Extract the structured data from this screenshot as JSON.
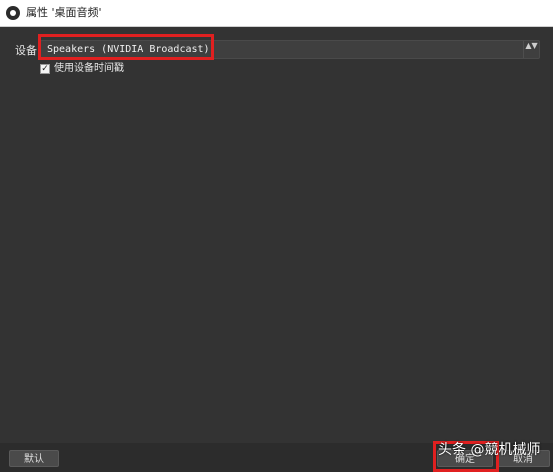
{
  "window": {
    "title": "属性 '桌面音频'",
    "icon": "obs-logo-icon"
  },
  "form": {
    "device_label": "设备",
    "device_value": "Speakers (NVIDIA Broadcast)",
    "combo_arrow": "▲▼",
    "use_timestamp_label": "使用设备时间戳",
    "use_timestamp_checked": true,
    "check_mark": "✓"
  },
  "buttons": {
    "defaults": "默认",
    "ok": "确定",
    "cancel": "取消"
  },
  "watermark": {
    "text": "头条 @競机械师"
  },
  "colors": {
    "background": "#333333",
    "highlight": "#e02020"
  }
}
